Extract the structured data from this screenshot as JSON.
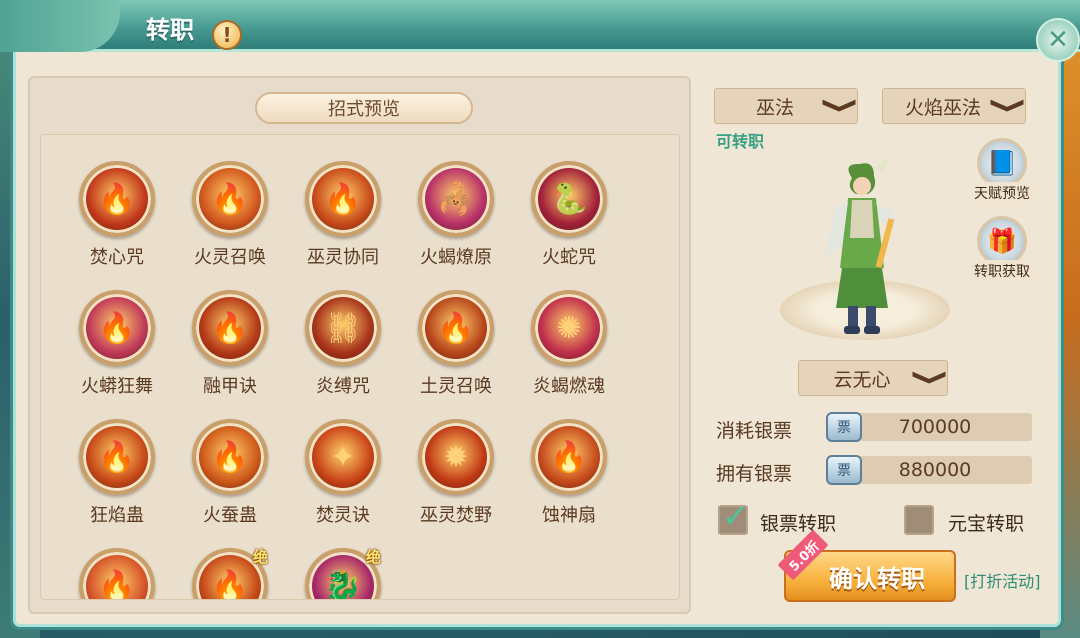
{
  "window": {
    "title": "转职",
    "alert_symbol": "!",
    "close_symbol": "✕"
  },
  "preview": {
    "title": "招式预览"
  },
  "skills": [
    {
      "name": "焚心咒",
      "icon": "flame-heart-icon",
      "glyph": "🔥",
      "color": "#c33a1c",
      "badge": ""
    },
    {
      "name": "火灵召唤",
      "icon": "fire-spirit-icon",
      "glyph": "🔥",
      "color": "#d2581e",
      "badge": ""
    },
    {
      "name": "巫灵协同",
      "icon": "shaman-spirit-icon",
      "glyph": "🔥",
      "color": "#c94b1a",
      "badge": ""
    },
    {
      "name": "火蝎燎原",
      "icon": "fire-scorpion-icon",
      "glyph": "🦂",
      "color": "#b8326a",
      "badge": ""
    },
    {
      "name": "火蛇咒",
      "icon": "fire-snake-icon",
      "glyph": "🐍",
      "color": "#a3223a",
      "badge": ""
    },
    {
      "name": "火蟒狂舞",
      "icon": "fire-python-icon",
      "glyph": "🔥",
      "color": "#c23b5a",
      "badge": ""
    },
    {
      "name": "融甲诀",
      "icon": "melt-armor-icon",
      "glyph": "🔥",
      "color": "#b53a18",
      "badge": ""
    },
    {
      "name": "炎缚咒",
      "icon": "flame-bind-icon",
      "glyph": "⛓",
      "color": "#a8341c",
      "badge": ""
    },
    {
      "name": "土灵召唤",
      "icon": "earth-spirit-icon",
      "glyph": "🔥",
      "color": "#b9471c",
      "badge": ""
    },
    {
      "name": "炎蝎燃魂",
      "icon": "flame-scorpion-icon",
      "glyph": "✺",
      "color": "#c0304c",
      "badge": ""
    },
    {
      "name": "狂焰蛊",
      "icon": "wild-flame-icon",
      "glyph": "🔥",
      "color": "#c84a18",
      "badge": ""
    },
    {
      "name": "火蚕蛊",
      "icon": "fire-silkworm-icon",
      "glyph": "🔥",
      "color": "#cf5a1a",
      "badge": ""
    },
    {
      "name": "焚灵诀",
      "icon": "burn-spirit-icon",
      "glyph": "✦",
      "color": "#c94418",
      "badge": ""
    },
    {
      "name": "巫灵焚野",
      "icon": "shaman-burn-icon",
      "glyph": "✹",
      "color": "#c23a16",
      "badge": ""
    },
    {
      "name": "蚀神扇",
      "icon": "erosion-fan-icon",
      "glyph": "🔥",
      "color": "#c74b1d",
      "badge": ""
    },
    {
      "name": "",
      "icon": "flame-lotus-icon",
      "glyph": "🔥",
      "color": "#d6552a",
      "badge": ""
    },
    {
      "name": "",
      "icon": "fire-demon-icon",
      "glyph": "🔥",
      "color": "#c64a1a",
      "badge": "绝"
    },
    {
      "name": "",
      "icon": "fire-dragon-icon",
      "glyph": "🐉",
      "color": "#a8286a",
      "badge": "绝"
    }
  ],
  "job": {
    "class_select": "巫法",
    "sub_class_select": "火焰巫法",
    "status": "可转职",
    "character_select": "云无心",
    "chevron": "❯"
  },
  "side_buttons": {
    "talent_preview": "天赋预览",
    "transfer_get": "转职获取"
  },
  "costs": {
    "consume_label": "消耗银票",
    "consume_value": "700000",
    "own_label": "拥有银票",
    "own_value": "880000"
  },
  "payment": {
    "silver_label": "银票转职",
    "silver_checked": true,
    "ingot_label": "元宝转职",
    "ingot_checked": false,
    "check_symbol": "✓"
  },
  "confirm": {
    "label": "确认转职",
    "discount": "5.0折",
    "event_link": "[打折活动]"
  }
}
